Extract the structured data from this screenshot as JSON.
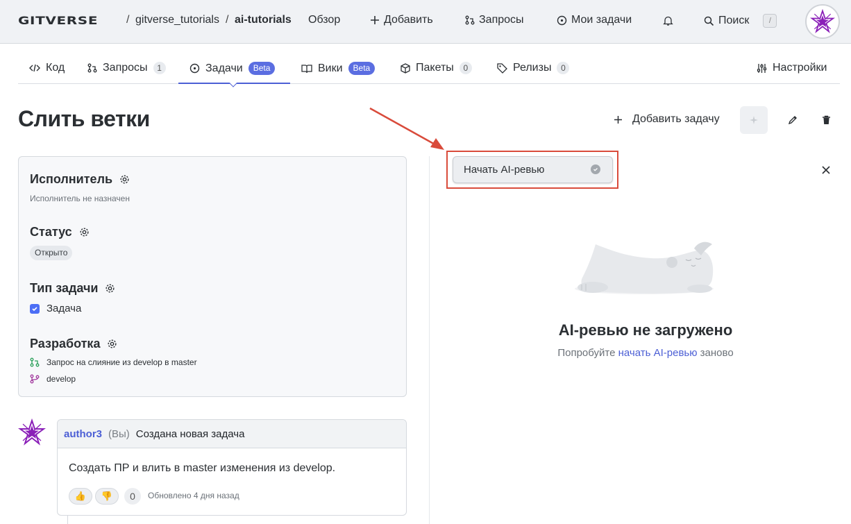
{
  "topbar": {
    "logo": "GITVERSE",
    "breadcrumb": [
      "gitverse_tutorials",
      "ai-tutorials"
    ],
    "separator": "/",
    "nav": {
      "overview": "Обзор",
      "add": "Добавить",
      "requests": "Запросы",
      "my_tasks": "Мои задачи",
      "search": "Поиск",
      "search_shortcut": "/"
    }
  },
  "tabs": [
    {
      "label": "Код"
    },
    {
      "label": "Запросы",
      "count": "1"
    },
    {
      "label": "Задачи",
      "badge": "Beta",
      "active": true
    },
    {
      "label": "Вики",
      "badge": "Beta"
    },
    {
      "label": "Пакеты",
      "count": "0"
    },
    {
      "label": "Релизы",
      "count": "0"
    }
  ],
  "settings_label": "Настройки",
  "page_title": "Слить ветки",
  "actions": {
    "add_task": "Добавить задачу"
  },
  "sidebar": {
    "assignee_title": "Исполнитель",
    "assignee_value": "Исполнитель не назначен",
    "status_title": "Статус",
    "status_value": "Открыто",
    "type_title": "Тип задачи",
    "type_value": "Задача",
    "dev_title": "Разработка",
    "dev_merge_request": "Запрос на слияние из develop в master",
    "dev_branch": "develop"
  },
  "ai_review": {
    "start_button": "Начать AI-ревью",
    "empty_title": "AI-ревью не загружено",
    "empty_sub_before": "Попробуйте ",
    "empty_sub_link": "начать AI-ревью",
    "empty_sub_after": " заново"
  },
  "comment": {
    "author": "author3",
    "you": "(Вы)",
    "action": "Создана новая задача",
    "body": "Создать ПР и влить в master изменения из develop.",
    "reaction_count": "0",
    "updated": "Обновлено 4 дня назад"
  },
  "colors": {
    "accent": "#4c5fd5",
    "beta_badge": "#5b6ee1",
    "highlight_box": "#d94b3b",
    "avatar_star": "#8a1fb8"
  }
}
